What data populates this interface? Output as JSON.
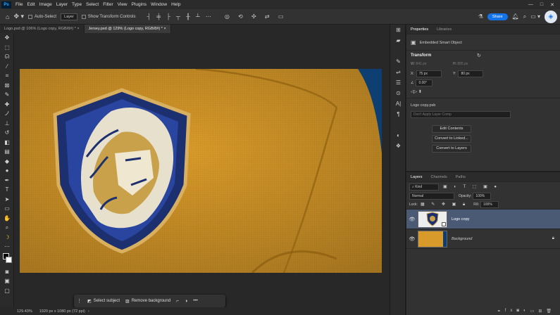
{
  "menubar": {
    "app_badge": "Ps",
    "items": [
      "File",
      "Edit",
      "Image",
      "Layer",
      "Type",
      "Select",
      "Filter",
      "View",
      "Plugins",
      "Window",
      "Help"
    ]
  },
  "optionsbar": {
    "auto_select_label": "Auto-Select",
    "layer_dropdown": "Layer",
    "transform_controls_label": "Show Transform Controls",
    "share_label": "Share"
  },
  "tabs": [
    {
      "label": "Logo.psd @ 106% (Logo copy, RGB/8#) *",
      "close": "×"
    },
    {
      "label": "Jersey.psd @ 129% (Logo copy, RGB/8#) *",
      "close": "×"
    }
  ],
  "context_taskbar": {
    "select_subject": "Select subject",
    "remove_background": "Remove background",
    "more": "•••"
  },
  "statusbar": {
    "zoom": "129.43%",
    "doc_info": "1920 px x 1080 px (72 ppi)"
  },
  "properties": {
    "tabs": [
      "Properties",
      "Libraries"
    ],
    "object_type": "Embedded Smart Object",
    "transform_heading": "Transform",
    "w_label": "W:",
    "w_value": "841 px",
    "h_label": "H:",
    "h_value": "895 px",
    "x_label": "X:",
    "x_value": "75 px",
    "y_label": "Y:",
    "y_value": "80 px",
    "angle_value": "0.00°",
    "file_name": "Logo copy.psb",
    "layer_comp_placeholder": "Don't Apply Layer Comp",
    "edit_contents": "Edit Contents",
    "convert_linked": "Convert to Linked...",
    "convert_layers": "Convert to Layers"
  },
  "layers": {
    "tabs": [
      "Layers",
      "Channels",
      "Paths"
    ],
    "filter_kind": "Kind",
    "blend_mode": "Normal",
    "opacity_label": "Opacity:",
    "opacity_value": "100%",
    "lock_label": "Lock:",
    "fill_label": "Fill:",
    "fill_value": "100%",
    "items": [
      {
        "name": "Logo copy",
        "selected": true
      },
      {
        "name": "Background",
        "selected": false
      }
    ]
  },
  "colors": {
    "accent": "#1473e6",
    "jersey": "#d89a2a",
    "sky": "#0d3f73"
  }
}
